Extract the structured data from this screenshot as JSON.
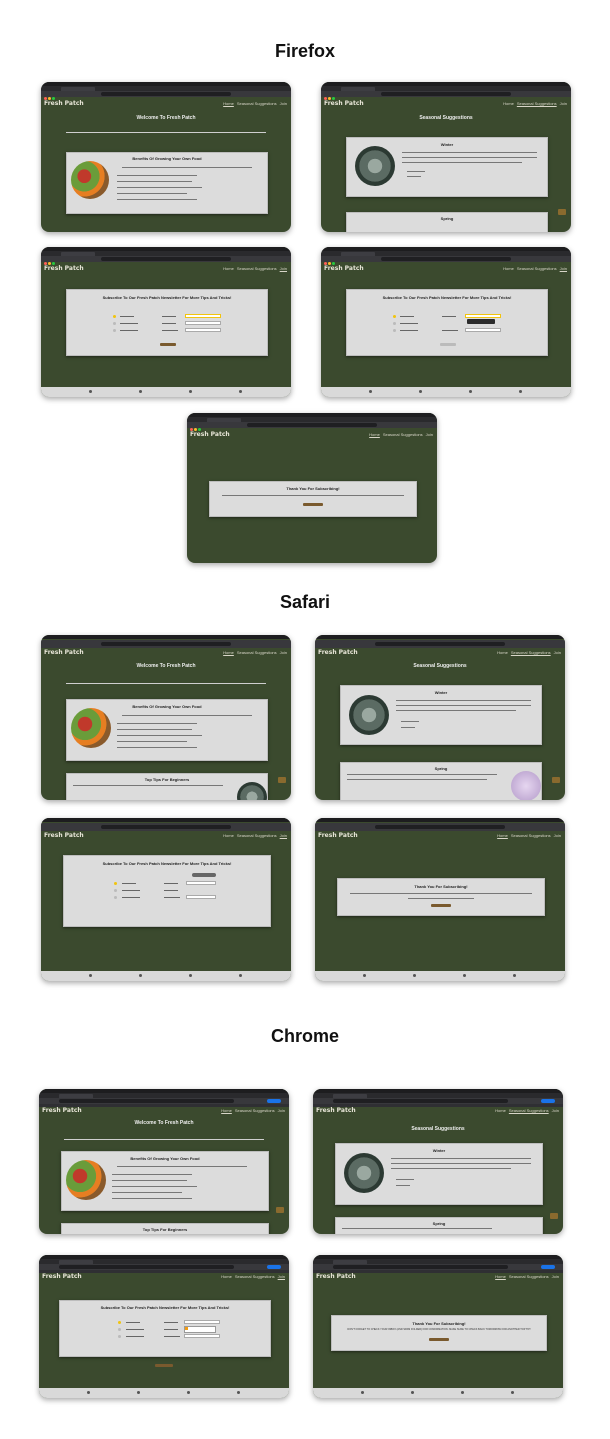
{
  "sections": {
    "firefox": "Firefox",
    "safari": "Safari",
    "chrome": "Chrome"
  },
  "site": {
    "logo": "Fresh Patch",
    "nav": [
      "Home",
      "Seasonal Suggestions",
      "Join"
    ],
    "home_title": "Welcome To Fresh Patch",
    "benefits_title": "Benefits Of Growing Your Own Food",
    "beginners_title": "Top Tips For Beginners",
    "seasonal_title": "Seasonal Suggestions",
    "winter_title": "Winter",
    "spring_title": "Spring",
    "subscribe_title": "Subscribe To Our Fresh Patch Newsletter For More Tips And Tricks!",
    "thanks_title": "Thank You For Subscribing!",
    "thanks_text": "DON'T FORGET TO CHECK YOUR INBOX (AND SPAM FOLDER) FOR CONFIRMATION. MAKE SURE TO CHECK BACK TOMORROW FOR ANOTHER TOP TIP!",
    "levels": [
      "Beginner",
      "Intermediate",
      "Experienced"
    ],
    "fields": [
      "First Name",
      "Last Name",
      "Email Address"
    ],
    "tip_button": "Tip"
  }
}
